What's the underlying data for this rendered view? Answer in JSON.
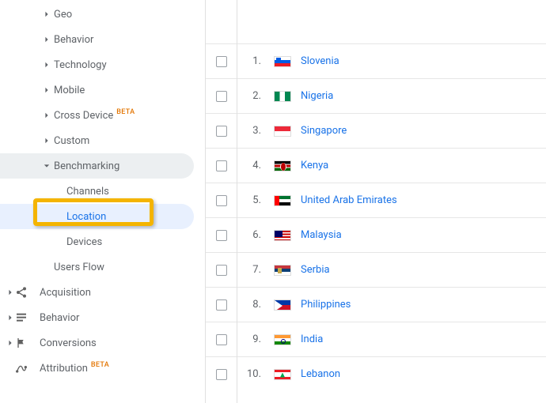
{
  "sidebar": {
    "items_l2": [
      {
        "label": "Geo",
        "beta": false
      },
      {
        "label": "Behavior",
        "beta": false
      },
      {
        "label": "Technology",
        "beta": false
      },
      {
        "label": "Mobile",
        "beta": false
      },
      {
        "label": "Cross Device",
        "beta": true
      },
      {
        "label": "Custom",
        "beta": false
      }
    ],
    "benchmarking": {
      "label": "Benchmarking"
    },
    "bench_children": [
      {
        "label": "Channels"
      },
      {
        "label": "Location"
      },
      {
        "label": "Devices"
      }
    ],
    "users_flow": {
      "label": "Users Flow"
    },
    "sections": [
      {
        "label": "Acquisition",
        "beta": false,
        "icon": "share"
      },
      {
        "label": "Behavior",
        "beta": false,
        "icon": "list"
      },
      {
        "label": "Conversions",
        "beta": false,
        "icon": "flag"
      },
      {
        "label": "Attribution",
        "beta": true,
        "icon": "attribution"
      }
    ],
    "beta_text": "BETA"
  },
  "table": {
    "rows": [
      {
        "rank": "1.",
        "country": "Slovenia",
        "flag": "si"
      },
      {
        "rank": "2.",
        "country": "Nigeria",
        "flag": "ng"
      },
      {
        "rank": "3.",
        "country": "Singapore",
        "flag": "sg"
      },
      {
        "rank": "4.",
        "country": "Kenya",
        "flag": "ke"
      },
      {
        "rank": "5.",
        "country": "United Arab Emirates",
        "flag": "ae"
      },
      {
        "rank": "6.",
        "country": "Malaysia",
        "flag": "my"
      },
      {
        "rank": "7.",
        "country": "Serbia",
        "flag": "rs"
      },
      {
        "rank": "8.",
        "country": "Philippines",
        "flag": "ph"
      },
      {
        "rank": "9.",
        "country": "India",
        "flag": "in"
      },
      {
        "rank": "10.",
        "country": "Lebanon",
        "flag": "lb"
      }
    ]
  }
}
